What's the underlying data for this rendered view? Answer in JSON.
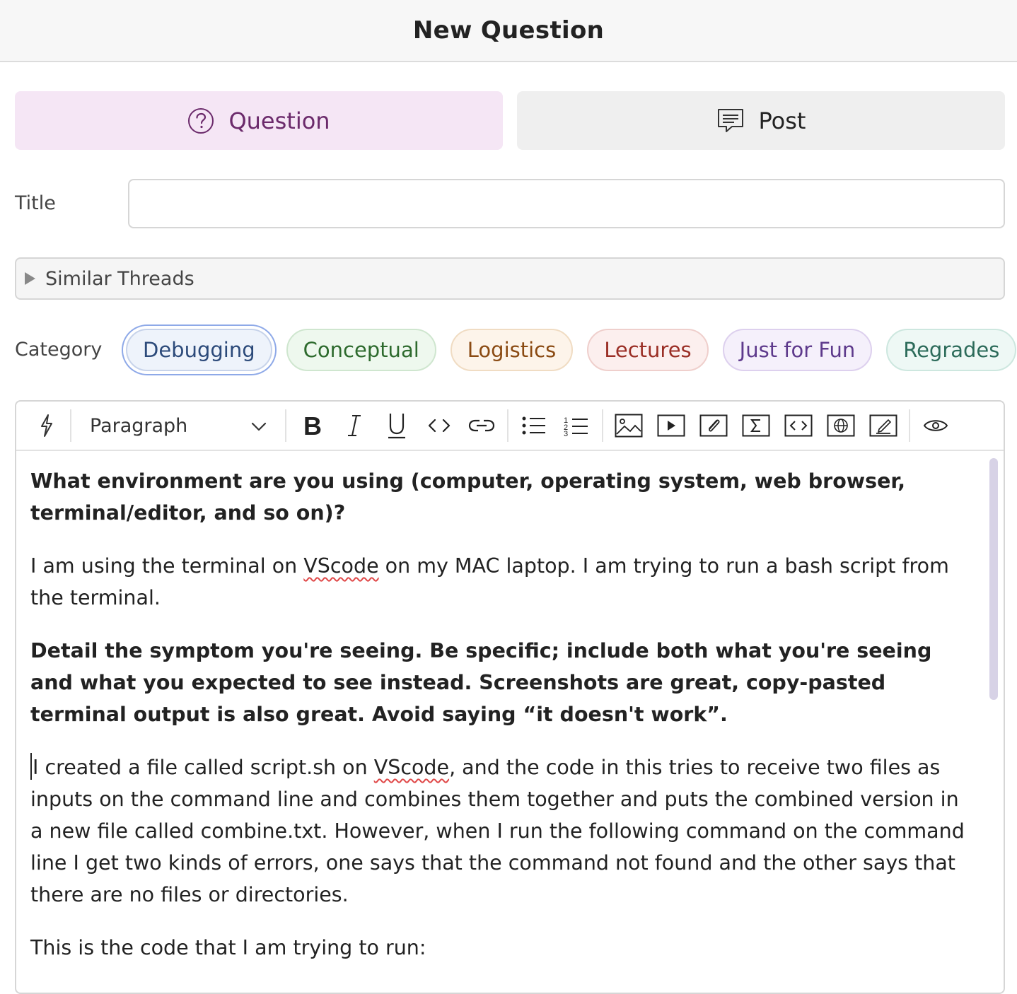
{
  "header": {
    "title": "New Question"
  },
  "post_type": {
    "question_label": "Question",
    "post_label": "Post"
  },
  "title_field": {
    "label": "Title",
    "value": "",
    "placeholder": ""
  },
  "similar_threads": {
    "label": "Similar Threads"
  },
  "category": {
    "label": "Category",
    "chips": [
      {
        "label": "Debugging",
        "selected": true,
        "color": "#2c4a7a"
      },
      {
        "label": "Conceptual",
        "selected": false,
        "color": "#2d6a2d"
      },
      {
        "label": "Logistics",
        "selected": false,
        "color": "#8a4a12"
      },
      {
        "label": "Lectures",
        "selected": false,
        "color": "#9a2e25"
      },
      {
        "label": "Just for Fun",
        "selected": false,
        "color": "#5e3a8c"
      },
      {
        "label": "Regrades",
        "selected": false,
        "color": "#2c6b5a"
      }
    ]
  },
  "toolbar": {
    "paragraph_style": "Paragraph",
    "icons": [
      "lightning-icon",
      "bold-icon",
      "italic-icon",
      "underline-icon",
      "code-inline-icon",
      "link-icon",
      "bullet-list-icon",
      "numbered-list-icon",
      "image-icon",
      "video-icon",
      "attachment-icon",
      "math-icon",
      "code-block-icon",
      "web-embed-icon",
      "draw-icon",
      "preview-icon"
    ]
  },
  "editor": {
    "q1": "What environment are you using (computer, operating system, web browser, terminal/editor, and so on)?",
    "a1_before": "I am using the terminal on ",
    "a1_word": "VScode",
    "a1_after": " on my MAC laptop. I am trying to run a bash script from the terminal.",
    "q2": "Detail the symptom you're seeing. Be specific; include both what you're seeing and what you expected to see instead. Screenshots are great, copy-pasted terminal output is also great. Avoid saying “it doesn't work”.",
    "a2_before": "I created a file called script.sh on ",
    "a2_word": "VScode",
    "a2_after": ", and the code in this tries to receive two files as inputs on the command line and combines them together and puts the combined version in a new file called combine.txt. However, when I run the following command on the command line I get two kinds of errors, one says that the command not found and the other says that there are no files or directories.",
    "a3": "This is the code that I am trying to run:"
  }
}
